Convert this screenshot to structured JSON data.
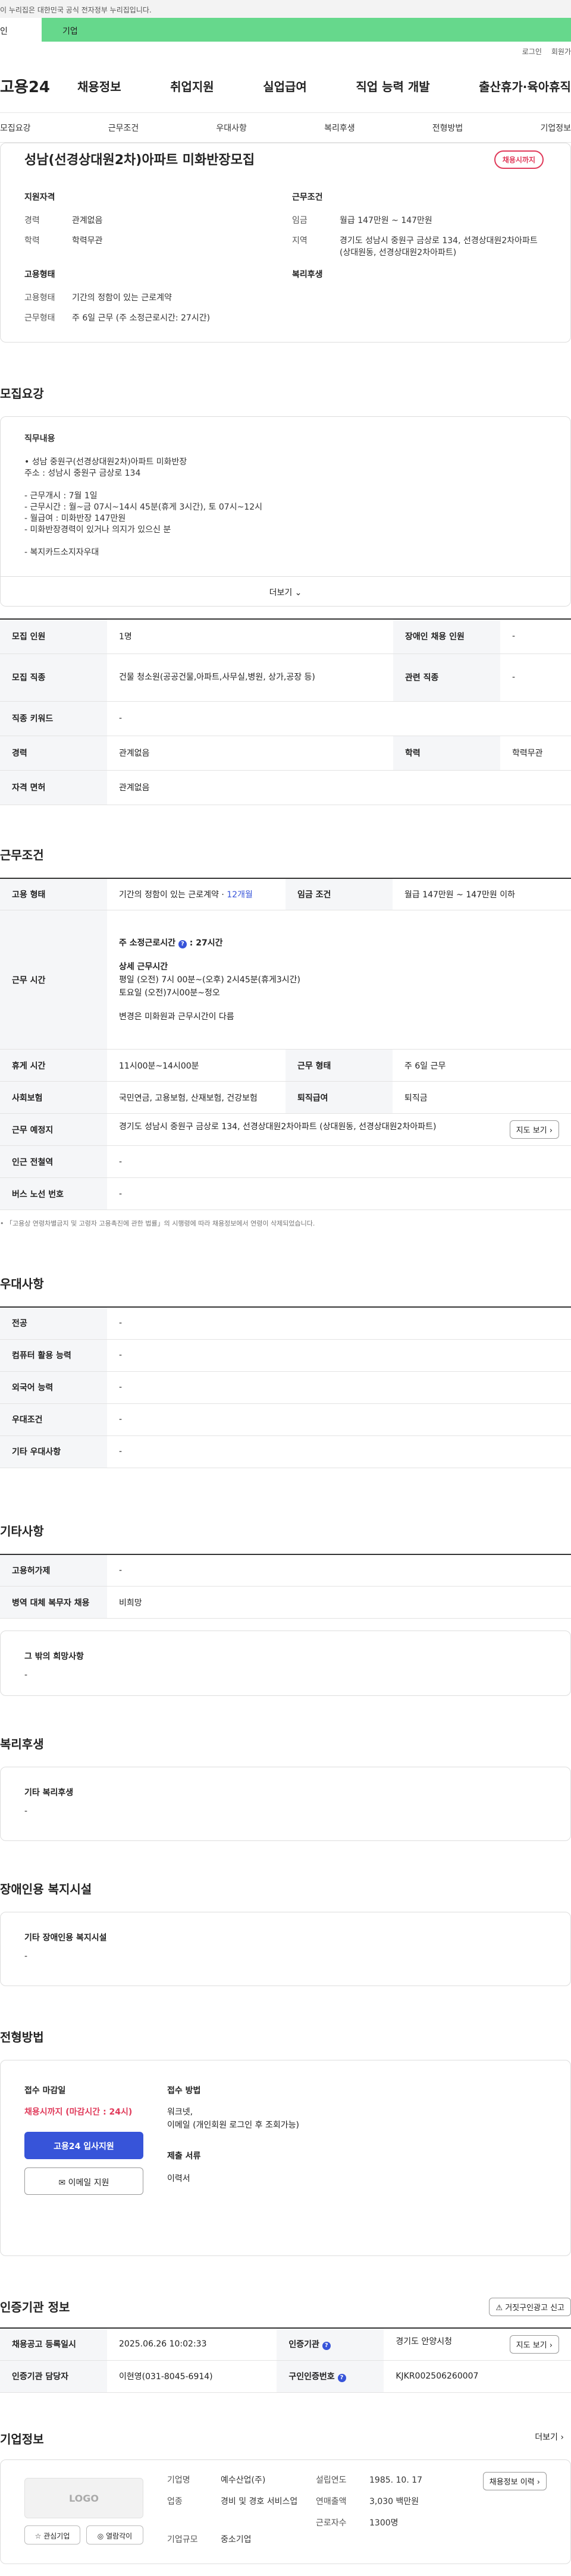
{
  "gov_bar": {
    "text": "이 누리집은 대한민국 공식 전자정부 누리집입니다."
  },
  "tabs": {
    "t1": "인",
    "t2": "기업"
  },
  "util": {
    "login": "로그인",
    "join": "회원가"
  },
  "gnb": {
    "logo": "고용24",
    "menu": [
      "채용정보",
      "취업지원",
      "실업급여",
      "직업 능력 개발",
      "출산휴가·육아휴직"
    ]
  },
  "subnav": [
    "모집요강",
    "근무조건",
    "우대사항",
    "복리후생",
    "전형방법",
    "기업정보"
  ],
  "summary": {
    "title": "성남(선경상대원2차)아파트 미화반장모집",
    "status": "채용시까지",
    "qual_title": "지원자격",
    "qual": [
      {
        "k": "경력",
        "v": "관계없음"
      },
      {
        "k": "학력",
        "v": "학력무관"
      }
    ],
    "cond_title": "근무조건",
    "cond": [
      {
        "k": "임금",
        "v": "월급 147만원 ~ 147만원"
      },
      {
        "k": "지역",
        "v": "경기도 성남시 중원구 금상로 134, 선경상대원2차아파트 (상대원동, 선경상대원2차아파트)"
      }
    ],
    "emp_title": "고용형태",
    "emp": [
      {
        "k": "고용형태",
        "v": "기간의 정함이 있는 근로계약"
      },
      {
        "k": "근무형태",
        "v": "주 6일 근무 (주 소정근로시간: 27시간)"
      }
    ],
    "welfare_title": "복리후생"
  },
  "recruit": {
    "title": "모집요강",
    "detail_heading": "직무내용",
    "detail_lines": [
      "• 성남 중원구(선경상대원2차)아파트 미화반장",
      "   주소 : 성남시 중원구 금상로 134",
      "",
      "- 근무개시 : 7월 1일",
      "- 근무시간 : 월~금 07시~14시 45분(휴게 3시간), 토 07시~12시",
      "- 월급여 : 미화반장 147만원",
      "- 미화반장경력이 있거나 의지가 있으신 분",
      "",
      "- 복지카드소지자우대"
    ],
    "more_label": "더보기",
    "rows": [
      [
        {
          "th": "모집 인원",
          "td": "1명"
        },
        {
          "th": "장애인 채용 인원",
          "td": "-"
        }
      ],
      [
        {
          "th": "모집 직종",
          "td": "건물 청소원(공공건물,아파트,사무실,병원, 상가,공장 등)"
        },
        {
          "th": "관련 직종",
          "td": "-"
        }
      ],
      [
        {
          "th": "직종 키워드",
          "td": "-"
        }
      ],
      [
        {
          "th": "경력",
          "td": "관계없음"
        },
        {
          "th": "학력",
          "td": "학력무관"
        }
      ],
      [
        {
          "th": "자격 면허",
          "td": "관계없음"
        }
      ]
    ]
  },
  "work": {
    "title": "근무조건",
    "emp_type_th": "고용 형태",
    "emp_type_td": "기간의 정함이 있는 근로계약 · ",
    "emp_type_period": "12개월",
    "wage_th": "임금 조건",
    "wage_td": "월급 147만원 ~ 147만원 이하",
    "hours_th": "근무 시간",
    "hours_week": "주 소정근로시간",
    "hours_value": ": 27시간",
    "hours_detail_h": "상세 근무시간",
    "hours_detail": [
      "평일 (오전) 7시 00분~(오후) 2시45분(휴게3시간)",
      "토요일 (오전)7시00분~정오"
    ],
    "hours_note": "변경은 미화원과 근무시간이 다름",
    "break_th": "휴게 시간",
    "break_td": "11시00분~14시00분",
    "form_th": "근무 형태",
    "form_td": "주 6일 근무",
    "ins_th": "사회보험",
    "ins_td": "국민연금, 고용보험, 산재보험, 건강보험",
    "ret_th": "퇴직급여",
    "ret_td": "퇴직금",
    "place_th": "근무 예정지",
    "place_td": "경기도 성남시 중원구 금상로 134, 선경상대원2차아파트 (상대원동, 선경상대원2차아파트)",
    "map_btn": "지도 보기",
    "subway_th": "인근 전철역",
    "subway_td": "-",
    "bus_th": "버스 노선 번호",
    "bus_td": "-",
    "note": "「고용상 연령차별금지 및 고령자 고용촉진에 관한 법률」의 시행령에 따라 채용정보에서 연령이 삭제되었습니다."
  },
  "pref": {
    "title": "우대사항",
    "rows": [
      {
        "th": "전공",
        "td": "-"
      },
      {
        "th": "컴퓨터 활용 능력",
        "td": "-"
      },
      {
        "th": "외국어 능력",
        "td": "-"
      },
      {
        "th": "우대조건",
        "td": "-"
      },
      {
        "th": "기타 우대사항",
        "td": "-"
      }
    ]
  },
  "etc": {
    "title": "기타사항",
    "rows": [
      {
        "th": "고용허가제",
        "td": "-"
      },
      {
        "th": "병역 대체 복무자 채용",
        "td": "비희망"
      }
    ],
    "box_h": "그 밖의 희망사항",
    "box_v": "-"
  },
  "welfare": {
    "title": "복리후생",
    "box_h": "기타 복리후생",
    "box_v": "-"
  },
  "disab": {
    "title": "장애인용 복지시설",
    "box_h": "기타 장애인용 복지시설",
    "box_v": "-"
  },
  "process": {
    "title": "전형방법",
    "deadline_h": "접수 마감일",
    "deadline_v": "채용시까지 (마감시간 : 24시)",
    "apply_btn": "고용24 입사지원",
    "email_btn": "이메일 지원",
    "method_h": "접수 방법",
    "method_v": [
      "워크넷,",
      "이메일 (개인회원 로그인 후 조회가능)"
    ],
    "docs_h": "제출 서류",
    "docs_v": "이력서"
  },
  "cert": {
    "title": "인증기관 정보",
    "report_btn": "거짓구인광고 신고",
    "rows": [
      [
        {
          "th": "채용공고 등록일시",
          "td": "2025.06.26 10:02:33"
        },
        {
          "th": "인증기관",
          "td": "경기도 안양시청"
        }
      ],
      [
        {
          "th": "인증기관 담당자",
          "td": "이현영(031-8045-6914)"
        },
        {
          "th": "구인인증번호",
          "td": "KJKR002506260007"
        }
      ]
    ],
    "map_btn": "지도 보기"
  },
  "company": {
    "title": "기업정보",
    "more": "더보기",
    "logo": "LOGO",
    "fav_btn": "관심기업",
    "talk_btn": "열람각이",
    "info": [
      {
        "k": "기업명",
        "v": "예수산업(주)"
      },
      {
        "k": "업종",
        "v": "경비 및 경호 서비스업"
      },
      {
        "k": "기업규모",
        "v": "중소기업"
      }
    ],
    "info2": [
      {
        "k": "설립연도",
        "v": "1985. 10. 17"
      },
      {
        "k": "연매출액",
        "v": "3,030 백만원"
      },
      {
        "k": "근로자수",
        "v": "1300명"
      }
    ],
    "jobs_btn": "채용정보 이력"
  }
}
